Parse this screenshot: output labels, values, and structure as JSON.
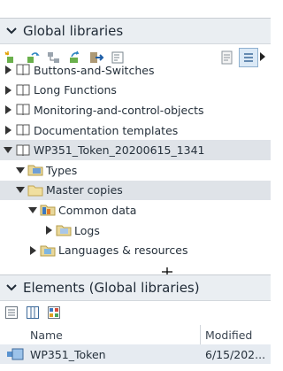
{
  "global_libraries": {
    "title": "Global libraries",
    "toolbar_icons": [
      "new-library-icon",
      "open-library-icon",
      "library-structure-icon",
      "update-library-icon",
      "export-icon",
      "library-view-icon",
      "properties-icon",
      "detail-view-icon"
    ],
    "tree": [
      {
        "label": "Buttons-and-Switches",
        "indent": 0,
        "expanded": false,
        "icon": "book-icon"
      },
      {
        "label": "Long Functions",
        "indent": 0,
        "expanded": false,
        "icon": "book-icon"
      },
      {
        "label": "Monitoring-and-control-objects",
        "indent": 0,
        "expanded": false,
        "icon": "book-icon"
      },
      {
        "label": "Documentation templates",
        "indent": 0,
        "expanded": false,
        "icon": "book-icon"
      },
      {
        "label": "WP351_Token_20200615_1341",
        "indent": 0,
        "expanded": true,
        "icon": "book-icon",
        "highlighted": true
      },
      {
        "label": "Types",
        "indent": 1,
        "expanded": true,
        "icon": "types-folder-icon"
      },
      {
        "label": "Master copies",
        "indent": 1,
        "expanded": true,
        "icon": "master-copies-folder-icon",
        "highlighted": true
      },
      {
        "label": "Common data",
        "indent": 1,
        "expanded": true,
        "icon": "common-data-folder-icon"
      },
      {
        "label": "Logs",
        "indent": 2,
        "expanded": false,
        "icon": "logs-folder-icon"
      },
      {
        "label": "Languages & resources",
        "indent": 1,
        "expanded": false,
        "icon": "languages-folder-icon"
      }
    ]
  },
  "elements": {
    "title": "Elements (Global libraries)",
    "toolbar_icons": [
      "list-view-icon",
      "details-view-icon",
      "overview-icon"
    ],
    "columns": {
      "name": "Name",
      "modified": "Modified"
    },
    "rows": [
      {
        "name": "WP351_Token",
        "modified": "6/15/202..."
      }
    ]
  }
}
